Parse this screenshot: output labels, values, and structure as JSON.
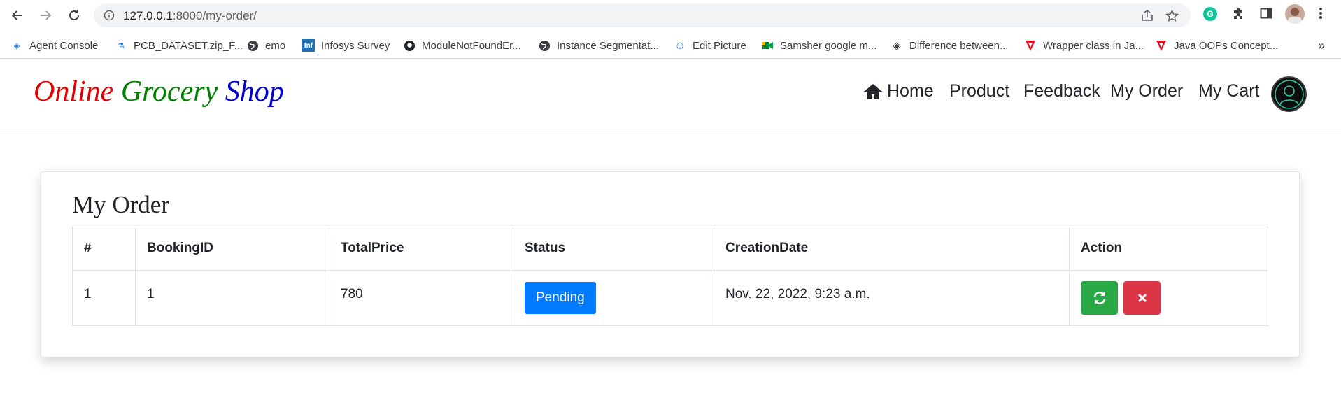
{
  "browser": {
    "url_host": "127.0.0.1",
    "url_rest": ":8000/my-order/",
    "bookmarks": [
      "Agent Console",
      "PCB_DATASET.zip_F...",
      "emo",
      "Infosys Survey",
      "ModuleNotFoundEr...",
      "Instance Segmentat...",
      "Edit Picture",
      "Samsher google m...",
      "Difference between...",
      "Wrapper class in Ja...",
      "Java OOPs Concept..."
    ],
    "more_bookmarks": "»"
  },
  "site": {
    "brand": {
      "word1": "Online",
      "word2": "Grocery",
      "word3": "Shop"
    },
    "menu": [
      "Home",
      "Product",
      "Feedback",
      "My Order",
      "My Cart"
    ]
  },
  "orders": {
    "title": "My Order",
    "headers": [
      "#",
      "BookingID",
      "TotalPrice",
      "Status",
      "CreationDate",
      "Action"
    ],
    "rows": [
      {
        "num": "1",
        "booking_id": "1",
        "total_price": "780",
        "status": "Pending",
        "date": "Nov. 22, 2022, 9:23 a.m."
      }
    ]
  },
  "colors": {
    "brand_word1": "#e00000",
    "brand_word2": "#008000",
    "brand_word3": "#0000d0",
    "status_badge": "#007bff",
    "refresh_button": "#28a745",
    "cancel_button": "#dc3545"
  },
  "icons": [
    "back-icon",
    "forward-icon",
    "reload-icon",
    "info-icon",
    "share-icon",
    "star-icon",
    "grammarly-icon",
    "extensions-icon",
    "sidepanel-icon",
    "profile-icon",
    "menu-icon",
    "home-icon",
    "refresh-icon",
    "close-icon"
  ]
}
